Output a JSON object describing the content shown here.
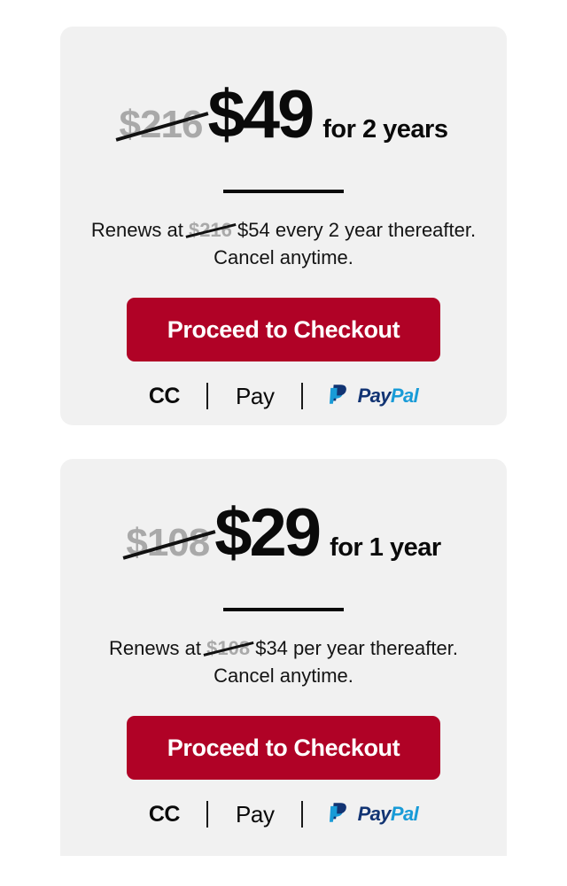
{
  "theme": {
    "page_background": "#ffffff",
    "card_background": "#f1f1f1",
    "cta_color": "#b00226",
    "strike_price_color": "#a9a9a9",
    "text_color": "#0a0a0a",
    "paypal_dark": "#123473",
    "paypal_light": "#199bd7"
  },
  "offers": [
    {
      "old_price": "$216",
      "new_price": "$49",
      "term": "for 2 years",
      "renewal": {
        "prefix": "Renews at",
        "old_price": "$216",
        "new_price": "$54",
        "suffix": "every 2 year thereafter.",
        "line2": "Cancel anytime."
      },
      "cta_label": "Proceed to Checkout",
      "payments": [
        {
          "name": "credit-card",
          "label": "CC"
        },
        {
          "name": "apple-pay",
          "logo": "",
          "label": "Pay"
        },
        {
          "name": "paypal",
          "label_dark": "Pay",
          "label_light": "Pal"
        }
      ]
    },
    {
      "old_price": "$108",
      "new_price": "$29",
      "term": "for 1 year",
      "renewal": {
        "prefix": "Renews at",
        "old_price": "$108",
        "new_price": "$34",
        "suffix": "per year thereafter.",
        "line2": "Cancel anytime."
      },
      "cta_label": "Proceed to Checkout",
      "payments": [
        {
          "name": "credit-card",
          "label": "CC"
        },
        {
          "name": "apple-pay",
          "logo": "",
          "label": "Pay"
        },
        {
          "name": "paypal",
          "label_dark": "Pay",
          "label_light": "Pal"
        }
      ]
    }
  ]
}
